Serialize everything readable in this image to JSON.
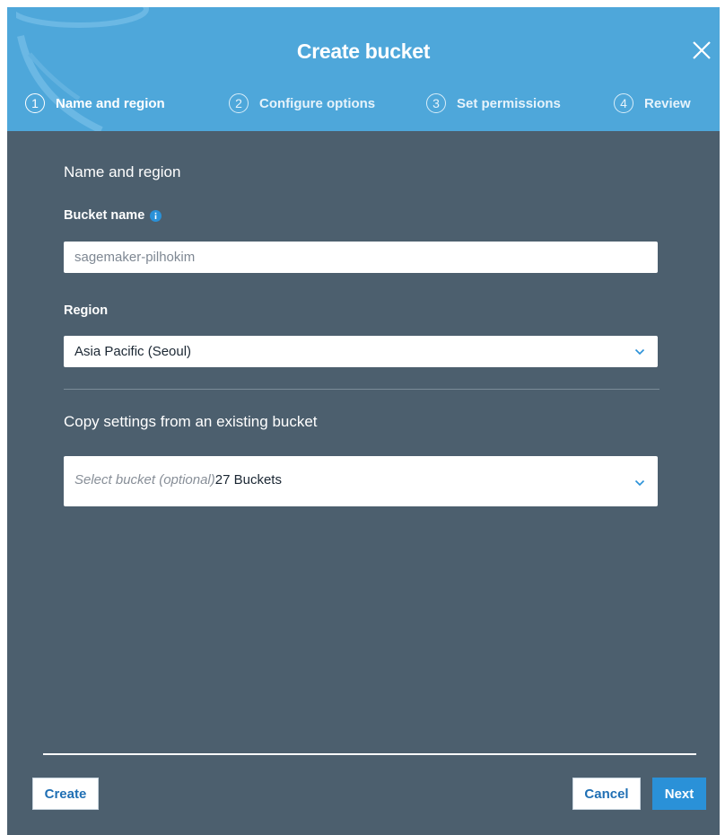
{
  "dialog": {
    "title": "Create bucket"
  },
  "steps": [
    {
      "number": "1",
      "label": "Name and region"
    },
    {
      "number": "2",
      "label": "Configure options"
    },
    {
      "number": "3",
      "label": "Set permissions"
    },
    {
      "number": "4",
      "label": "Review"
    }
  ],
  "form": {
    "section_title": "Name and region",
    "bucket_name_label": "Bucket name",
    "bucket_name_value": "sagemaker-pilhokim",
    "region_label": "Region",
    "region_value": "Asia Pacific (Seoul)",
    "copy_title": "Copy settings from an existing bucket",
    "copy_placeholder": "Select bucket (optional)",
    "copy_count": "27 Buckets"
  },
  "footer": {
    "create_label": "Create",
    "cancel_label": "Cancel",
    "next_label": "Next"
  },
  "colors": {
    "header": "#4ea7da",
    "body": "#4c5f6e",
    "primary": "#2a91d8",
    "link": "#1f6fb4"
  },
  "icons": {
    "close": "close-icon",
    "info": "info-icon",
    "dropdown": "chevron-down-icon"
  }
}
